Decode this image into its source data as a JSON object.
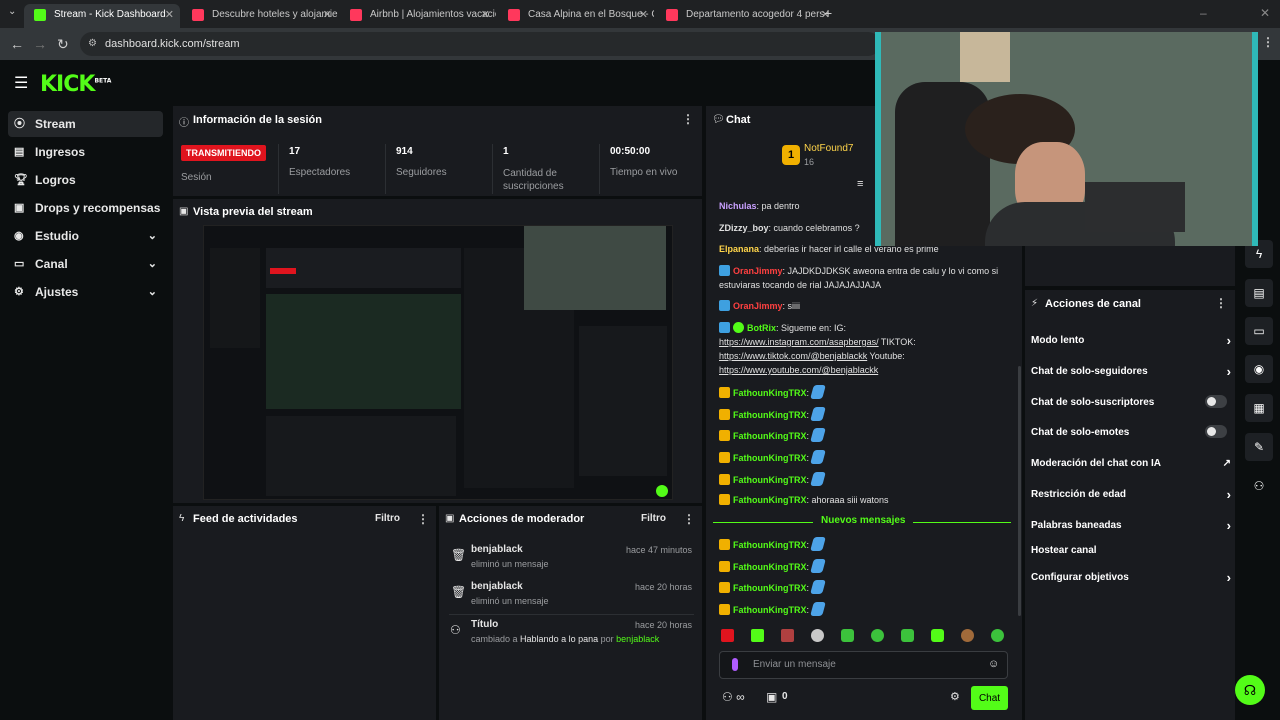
{
  "browser": {
    "tabs": [
      {
        "label": "Stream - Kick Dashboard",
        "color": "#53fc18"
      },
      {
        "label": "Descubre hoteles y alojamiento",
        "color": "#ff385c"
      },
      {
        "label": "Airbnb | Alojamientos vacacion",
        "color": "#ff385c"
      },
      {
        "label": "Casa Alpina en el Bosque - Cab",
        "color": "#ff385c"
      },
      {
        "label": "Departamento acogedor 4 pers",
        "color": "#ff385c"
      }
    ],
    "url": "dashboard.kick.com/stream"
  },
  "header": {
    "logo": "KICK",
    "logo_sup": "BETA"
  },
  "sidebar": {
    "items": [
      {
        "label": "Stream",
        "icon": "stream-icon"
      },
      {
        "label": "Ingresos",
        "icon": "revenue-icon"
      },
      {
        "label": "Logros",
        "icon": "trophy-icon"
      },
      {
        "label": "Drops y recompensas",
        "icon": "gift-icon"
      },
      {
        "label": "Estudio",
        "icon": "studio-icon"
      },
      {
        "label": "Canal",
        "icon": "channel-icon"
      },
      {
        "label": "Ajustes",
        "icon": "gear-icon"
      }
    ]
  },
  "session": {
    "title": "Información de la sesión",
    "status": "TRANSMITIENDO",
    "status_label": "Sesión",
    "stats": [
      {
        "value": "17",
        "label": "Espectadores"
      },
      {
        "value": "914",
        "label": "Seguidores"
      },
      {
        "value": "1",
        "label": "Cantidad de suscripciones"
      },
      {
        "value": "00:50:00",
        "label": "Tiempo en vivo"
      }
    ]
  },
  "preview": {
    "title": "Vista previa del stream"
  },
  "feed": {
    "title": "Feed de actividades",
    "filter": "Filtro"
  },
  "mod": {
    "title": "Acciones de moderador",
    "filter": "Filtro",
    "items": [
      {
        "user": "benjablack",
        "action": "eliminó un mensaje",
        "time": "hace 47 minutos"
      },
      {
        "user": "benjablack",
        "action": "eliminó un mensaje",
        "time": "hace 20 horas"
      },
      {
        "user": "Título",
        "action_prefix": "cambiado a",
        "action_value": "Hablando a lo pana",
        "action_by": "por",
        "action_user": "benjablack",
        "time": "hace 20 horas"
      }
    ]
  },
  "chat": {
    "title": "Chat",
    "top_user": "NotFound7",
    "top_count": "16",
    "messages": [
      {
        "user": "Nichulas",
        "color": "#c9a0ff",
        "text": "pa dentro"
      },
      {
        "user": "ZDizzy_boy",
        "color": "#e0e0e0",
        "text": "cuando celebramos ?"
      },
      {
        "user": "Elpanana",
        "color": "#ffd54a",
        "text": "deberías ir hacer irl calle el verano es prime"
      },
      {
        "user": "OranJimmy",
        "color": "#ff4040",
        "text": "JAJDKDJDKSK aweona entra de calu y lo vi como si estuviaras tocando de rial JAJAJAJJAJA"
      },
      {
        "user": "OranJimmy",
        "color": "#ff4040",
        "text": "siiii"
      },
      {
        "user": "BotRix",
        "color": "#53fc18",
        "text": "Sigueme en: IG:",
        "links": [
          "https://www.instagram.com/asapbergas/",
          "TIKTOK:",
          "https://www.tiktok.com/@benjablackk",
          "Youtube:",
          "https://www.youtube.com/@benjablackk"
        ]
      },
      {
        "user": "FathounKingTRX",
        "color": "#53fc18",
        "text": ""
      },
      {
        "user": "FathounKingTRX",
        "color": "#53fc18",
        "text": ""
      },
      {
        "user": "FathounKingTRX",
        "color": "#53fc18",
        "text": ""
      },
      {
        "user": "FathounKingTRX",
        "color": "#53fc18",
        "text": ""
      },
      {
        "user": "FathounKingTRX",
        "color": "#53fc18",
        "text": ""
      },
      {
        "user": "FathounKingTRX",
        "color": "#53fc18",
        "text": "ahoraaa siii watons"
      }
    ],
    "new_messages": "Nuevos mensajes",
    "after": [
      {
        "user": "FathounKingTRX"
      },
      {
        "user": "FathounKingTRX"
      },
      {
        "user": "FathounKingTRX"
      },
      {
        "user": "FathounKingTRX"
      }
    ],
    "placeholder": "Enviar un mensaje",
    "points": "0",
    "send": "Chat"
  },
  "actions": {
    "title": "Acciones de canal",
    "items": [
      {
        "label": "Modo lento",
        "kind": "arrow"
      },
      {
        "label": "Chat de solo-seguidores",
        "kind": "arrow"
      },
      {
        "label": "Chat de solo-suscriptores",
        "kind": "toggle"
      },
      {
        "label": "Chat de solo-emotes",
        "kind": "toggle"
      },
      {
        "label": "Moderación del chat con IA",
        "kind": "external"
      },
      {
        "label": "Restricción de edad",
        "kind": "arrow"
      },
      {
        "label": "Palabras baneadas",
        "kind": "arrow"
      },
      {
        "label": "Hostear canal",
        "kind": "none"
      },
      {
        "label": "Configurar objetivos",
        "kind": "arrow"
      }
    ]
  },
  "colors": {
    "accent": "#53fc18",
    "live": "#e0141e",
    "panel": "#191b1f",
    "bg": "#0b0e0f"
  }
}
